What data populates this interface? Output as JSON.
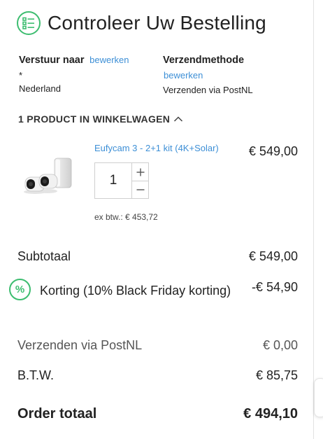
{
  "header": {
    "title": "Controleer Uw Bestelling",
    "icon": "list-checklist-icon"
  },
  "shipping": {
    "ship_to_label": "Verstuur naar",
    "ship_to_edit": "bewerken",
    "address_line1": "*",
    "address_country": "Nederland",
    "method_label": "Verzendmethode",
    "method_edit": "bewerken",
    "method_value": "Verzenden via PostNL"
  },
  "cart": {
    "toggle_label": "1 PRODUCT IN WINKELWAGEN",
    "items": [
      {
        "name": "Eufycam 3 - 2+1 kit (4K+Solar)",
        "price": "€ 549,00",
        "quantity": "1",
        "ex_tax": "ex btw.: € 453,72",
        "image": "security-camera-kit-image"
      }
    ]
  },
  "totals": {
    "subtotal_label": "Subtotaal",
    "subtotal_value": "€ 549,00",
    "discount_label": "Korting (10% Black Friday korting)",
    "discount_value": "-€ 54,90",
    "shipping_label": "Verzenden via PostNL",
    "shipping_value": "€ 0,00",
    "tax_label": "B.T.W.",
    "tax_value": "€ 85,75",
    "order_total_label": "Order totaal",
    "order_total_value": "€ 494,10"
  },
  "colors": {
    "accent_green": "#3dbd70",
    "link_blue": "#3d8fd6"
  }
}
